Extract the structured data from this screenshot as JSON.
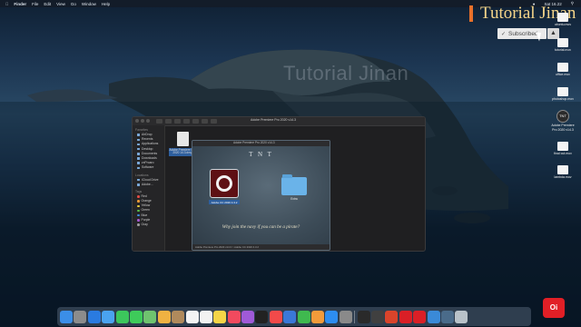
{
  "menubar": {
    "app": "Finder",
    "items": [
      "File",
      "Edit",
      "View",
      "Go",
      "Window",
      "Help"
    ],
    "clock": "Sat 16.22"
  },
  "watermark": "Tutorial Jinan",
  "brand": {
    "text": "Tutorial Jinan",
    "bar_color": "#e8702a",
    "text_color": "#f6d68a"
  },
  "subscribe": {
    "label": "Subscribed",
    "check_icon": "check-icon",
    "bell_icon": "bell-icon"
  },
  "desktop_icons": [
    {
      "label": "ubuntu.mov",
      "icon": "file-icon"
    },
    {
      "label": "tutorial.mov",
      "icon": "file-icon"
    },
    {
      "label": "office.mov",
      "icon": "file-icon"
    },
    {
      "label": "photoshop.mov",
      "icon": "file-icon"
    },
    {
      "label": "TNT",
      "icon": "tnt-logo-icon"
    },
    {
      "label": "Adobe Premiere Pro 2020 v14.3",
      "icon": "installer-icon"
    },
    {
      "label": "final cut.mov",
      "icon": "file-icon"
    },
    {
      "label": "lambda.mov",
      "icon": "file-icon"
    }
  ],
  "finder": {
    "window_title": "Adobe Premiere Pro 2020 v14.3",
    "sidebar": {
      "favorites_label": "Favorites",
      "favorites": [
        "AirDrop",
        "Recents",
        "Applications",
        "Desktop",
        "Documents",
        "Downloads",
        "zxProaro",
        "Software"
      ],
      "locations_label": "Locations",
      "locations": [
        "iCloud Drive",
        "Adobe..."
      ],
      "tags_label": "Tags",
      "tags": [
        {
          "name": "Red",
          "color": "#e14b44"
        },
        {
          "name": "Orange",
          "color": "#f09a37"
        },
        {
          "name": "Yellow",
          "color": "#f3d03e"
        },
        {
          "name": "Green",
          "color": "#5cbf4c"
        },
        {
          "name": "Blue",
          "color": "#3f8be0"
        },
        {
          "name": "Purple",
          "color": "#a657d1"
        },
        {
          "name": "Gray",
          "color": "#9a9a9a"
        }
      ]
    },
    "dmg_file": {
      "label": "Adobe Premiere Pro 2020 14.3.dmg"
    },
    "installer": {
      "title": "Adobe Premiere Pro 2020 v14.3",
      "heading": "T N T",
      "app_label": "Adobe CC 2020 4.3.2",
      "folder_label": "Extra",
      "motto": "Why join the navy if you can be a pirate?",
      "path": "Adobe Premiere Pro 2020 v14.3 > Adobe CC 2020 4.3.2"
    }
  },
  "dock": {
    "icons": [
      {
        "name": "finder",
        "color": "#3b8ee8"
      },
      {
        "name": "launchpad",
        "color": "#8c8c8c"
      },
      {
        "name": "safari",
        "color": "#2a7be0"
      },
      {
        "name": "mail",
        "color": "#4aa3f0"
      },
      {
        "name": "facetime",
        "color": "#3cc65c"
      },
      {
        "name": "messages",
        "color": "#3ecb5a"
      },
      {
        "name": "maps",
        "color": "#6fc36f"
      },
      {
        "name": "photos",
        "color": "#f0b242"
      },
      {
        "name": "contacts",
        "color": "#b08a5c"
      },
      {
        "name": "calendar",
        "color": "#f4f4f4"
      },
      {
        "name": "reminders",
        "color": "#f2f2f2"
      },
      {
        "name": "notes",
        "color": "#f5d547"
      },
      {
        "name": "music",
        "color": "#f24a5e"
      },
      {
        "name": "podcasts",
        "color": "#a05ad8"
      },
      {
        "name": "tv",
        "color": "#222222"
      },
      {
        "name": "news",
        "color": "#f24a4a"
      },
      {
        "name": "keynote",
        "color": "#3a78d8"
      },
      {
        "name": "numbers",
        "color": "#3fb94f"
      },
      {
        "name": "pages",
        "color": "#f29b3a"
      },
      {
        "name": "app-store",
        "color": "#2d8df0"
      },
      {
        "name": "system-preferences",
        "color": "#8a8a8a"
      },
      {
        "name": "terminal",
        "color": "#2a2a2a"
      },
      {
        "name": "activity",
        "color": "#404040"
      },
      {
        "name": "office",
        "color": "#d9442b"
      },
      {
        "name": "adobe",
        "color": "#da1f26"
      },
      {
        "name": "creative-cloud",
        "color": "#da1f26"
      },
      {
        "name": "downloads",
        "color": "#3a8ad8"
      },
      {
        "name": "files",
        "color": "#4a6b8a"
      },
      {
        "name": "trash",
        "color": "#b9c2c9"
      }
    ]
  },
  "corner_logo": {
    "text": "Oi"
  }
}
